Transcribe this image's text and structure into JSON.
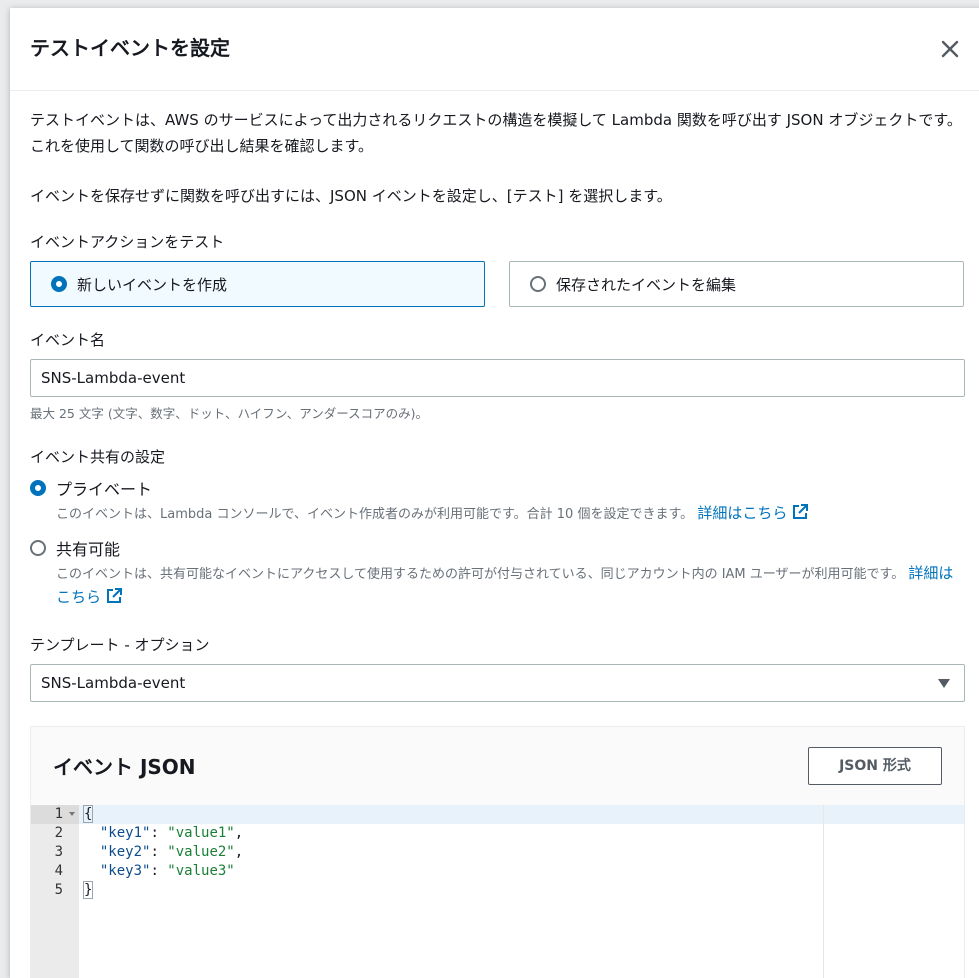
{
  "modal": {
    "title": "テストイベントを設定"
  },
  "description": {
    "para1": "テストイベントは、AWS のサービスによって出力されるリクエストの構造を模擬して Lambda 関数を呼び出す JSON オブジェクトです。これを使用して関数の呼び出し結果を確認します。",
    "para2": "イベントを保存せずに関数を呼び出すには、JSON イベントを設定し、[テスト] を選択します。"
  },
  "event_action": {
    "label": "イベントアクションをテスト",
    "options": [
      {
        "label": "新しいイベントを作成",
        "selected": true
      },
      {
        "label": "保存されたイベントを編集",
        "selected": false
      }
    ]
  },
  "event_name": {
    "label": "イベント名",
    "value": "SNS-Lambda-event",
    "hint": "最大 25 文字 (文字、数字、ドット、ハイフン、アンダースコアのみ)。"
  },
  "sharing": {
    "label": "イベント共有の設定",
    "private": {
      "label": "プライベート",
      "desc": "このイベントは、Lambda コンソールで、イベント作成者のみが利用可能です。合計 10 個を設定できます。",
      "link": "詳細はこちら",
      "selected": true
    },
    "shareable": {
      "label": "共有可能",
      "desc": "このイベントは、共有可能なイベントにアクセスして使用するための許可が付与されている、同じアカウント内の IAM ユーザーが利用可能です。",
      "link": "詳細はこちら",
      "selected": false
    }
  },
  "template": {
    "label": "テンプレート - オプション",
    "value": "SNS-Lambda-event"
  },
  "json_panel": {
    "title": "イベント JSON",
    "format_button": "JSON 形式",
    "line_numbers": [
      "1",
      "2",
      "3",
      "4",
      "5"
    ],
    "lines": [
      "{",
      "  \"key1\": \"value1\",",
      "  \"key2\": \"value2\",",
      "  \"key3\": \"value3\"",
      "}"
    ],
    "kv": [
      {
        "key": "\"key1\"",
        "value": "\"value1\"",
        "trail": ","
      },
      {
        "key": "\"key2\"",
        "value": "\"value2\"",
        "trail": ","
      },
      {
        "key": "\"key3\"",
        "value": "\"value3\"",
        "trail": ""
      }
    ],
    "open_brace": "{",
    "close_brace": "}"
  },
  "colors": {
    "accent": "#0073bb",
    "text": "#16191f",
    "muted": "#687078",
    "border": "#aab7b8"
  }
}
